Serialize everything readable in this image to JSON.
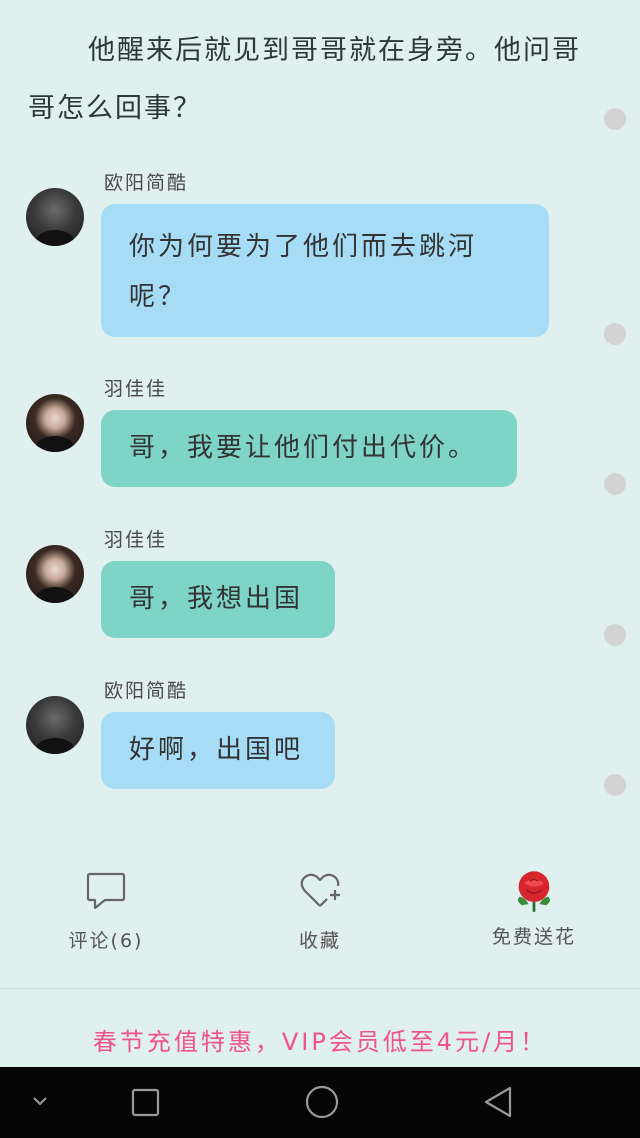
{
  "story": {
    "narration": "他醒来后就见到哥哥就在身旁。他问哥哥怎么回事？"
  },
  "messages": [
    {
      "sender": "欧阳简酷",
      "text": "你为何要为了他们而去跳河呢？"
    },
    {
      "sender": "羽佳佳",
      "text": "哥，我要让他们付出代价。"
    },
    {
      "sender": "羽佳佳",
      "text": "哥，我想出国"
    },
    {
      "sender": "欧阳简酷",
      "text": "好啊，出国吧"
    }
  ],
  "actions": {
    "comment": {
      "label": "评论(6)",
      "icon": "comment-bubble-icon"
    },
    "favorite": {
      "label": "收藏",
      "icon": "heart-plus-icon"
    },
    "flower": {
      "label": "免费送花",
      "icon": "rose-icon"
    }
  },
  "promo": {
    "text": "春节充值特惠，VIP会员低至4元/月！"
  },
  "nav": {
    "icons": [
      "chevron-down-icon",
      "recent-apps-icon",
      "home-icon",
      "back-icon"
    ]
  },
  "colors": {
    "background": "#dff0ee",
    "bubble_blue": "#a7dcf6",
    "bubble_teal": "#7fd4c8",
    "promo": "#f0528a"
  }
}
